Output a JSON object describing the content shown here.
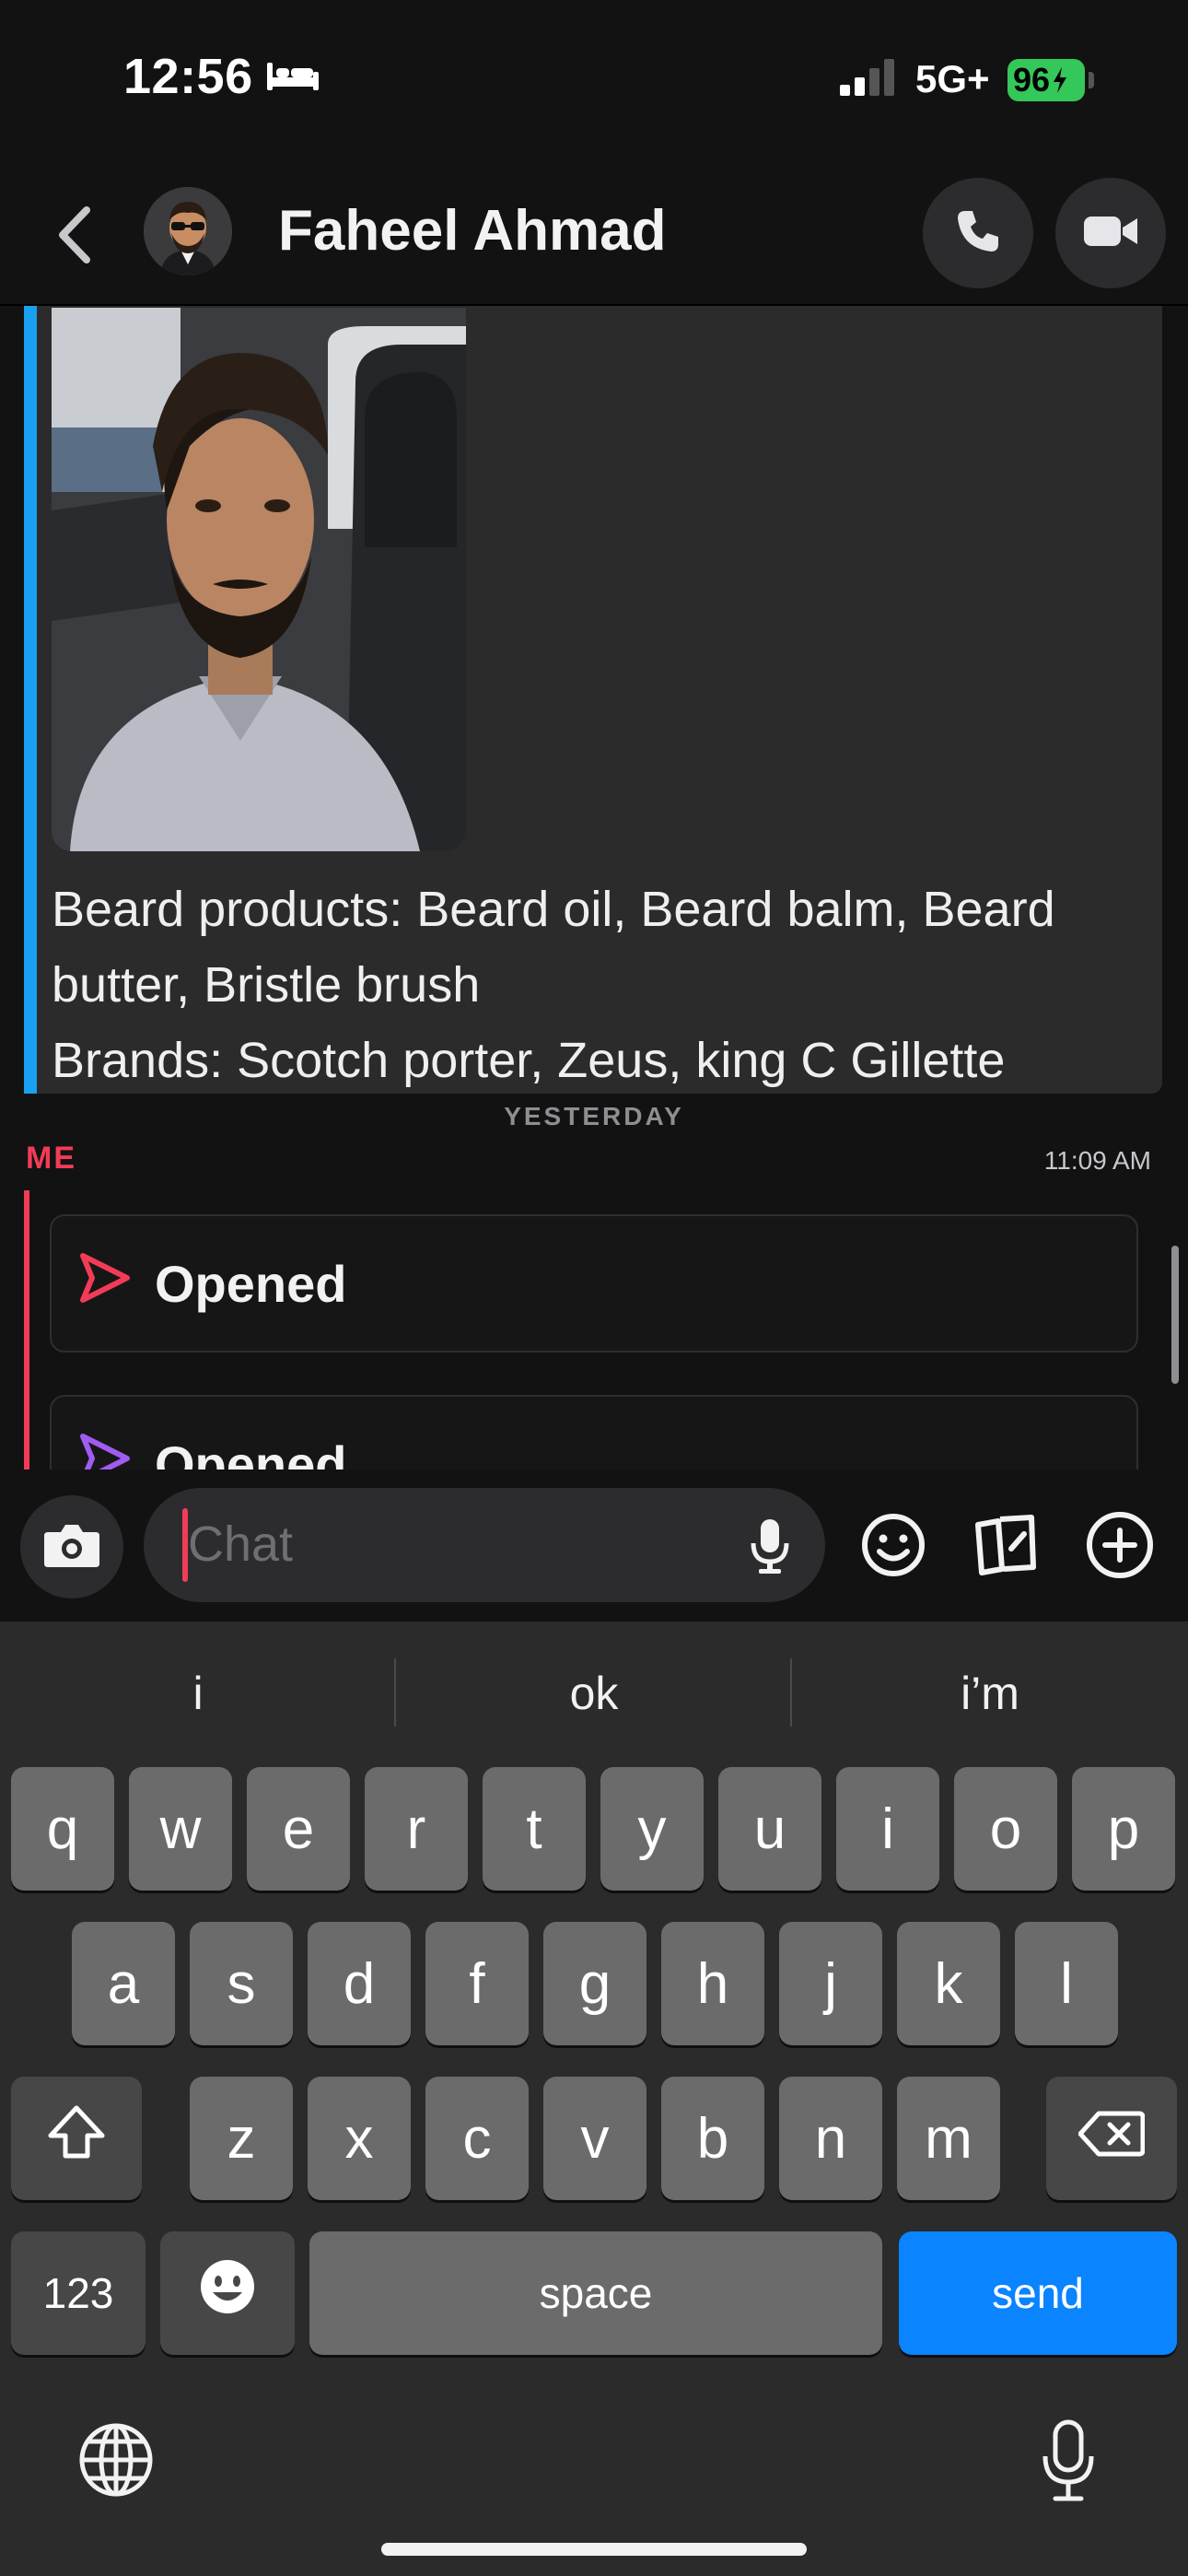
{
  "status_bar": {
    "time": "12:56",
    "network": "5G+",
    "battery": "96",
    "icons": [
      "bed-icon",
      "signal-icon",
      "battery-icon"
    ]
  },
  "header": {
    "contact_name": "Faheel Ahmad",
    "icons": [
      "back-chevron-icon",
      "phone-icon",
      "video-icon"
    ]
  },
  "messages": {
    "received": {
      "accent_color": "#19a1f0",
      "text_line_1": "Beard products: Beard oil, Beard balm, Beard butter, Bristle brush",
      "text_line_2": "Brands: Scotch porter, Zeus, king C Gillette"
    },
    "divider": "YESTERDAY",
    "sender_label": "ME",
    "sender_color": "#f23c57",
    "timestamp": "11:09 AM",
    "sent": [
      {
        "status": "Opened",
        "icon": "red-send-arrow-icon",
        "color": "#f23c57"
      },
      {
        "status": "Opened",
        "icon": "purple-send-arrow-icon",
        "color": "#a05cf0"
      }
    ]
  },
  "input": {
    "placeholder": "Chat",
    "icons": [
      "camera-icon",
      "mic-icon",
      "smiley-icon",
      "stickers-icon",
      "plus-icon"
    ]
  },
  "keyboard": {
    "suggestions": [
      "i",
      "ok",
      "i’m"
    ],
    "row1": [
      "q",
      "w",
      "e",
      "r",
      "t",
      "y",
      "u",
      "i",
      "o",
      "p"
    ],
    "row2": [
      "a",
      "s",
      "d",
      "f",
      "g",
      "h",
      "j",
      "k",
      "l"
    ],
    "row3": [
      "z",
      "x",
      "c",
      "v",
      "b",
      "n",
      "m"
    ],
    "numbers_key": "123",
    "space_key": "space",
    "send_key": "send",
    "send_color": "#0a84ff"
  }
}
